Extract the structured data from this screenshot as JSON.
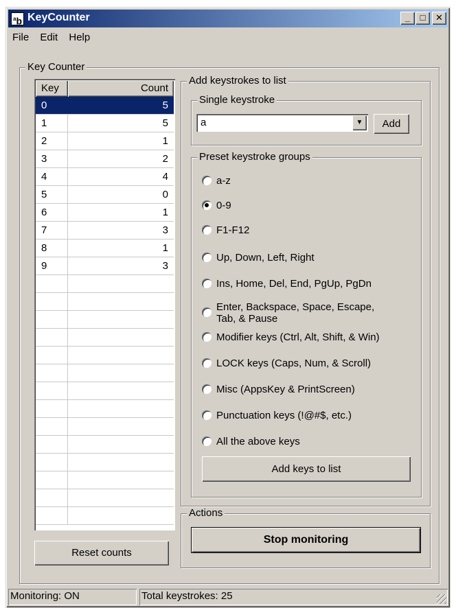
{
  "window": {
    "title": "KeyCounter",
    "icon_label": "ab",
    "minimize_label": "_",
    "maximize_label": "□",
    "close_label": "✕"
  },
  "menu": {
    "file": "File",
    "edit": "Edit",
    "help": "Help"
  },
  "key_counter": {
    "label": "Key Counter",
    "columns": {
      "key": "Key",
      "count": "Count"
    },
    "rows": [
      {
        "key": "0",
        "count": "5",
        "selected": true
      },
      {
        "key": "1",
        "count": "5"
      },
      {
        "key": "2",
        "count": "1"
      },
      {
        "key": "3",
        "count": "2"
      },
      {
        "key": "4",
        "count": "4"
      },
      {
        "key": "5",
        "count": "0"
      },
      {
        "key": "6",
        "count": "1"
      },
      {
        "key": "7",
        "count": "3"
      },
      {
        "key": "8",
        "count": "1"
      },
      {
        "key": "9",
        "count": "3"
      }
    ],
    "reset_button": "Reset counts"
  },
  "add_keystrokes": {
    "label": "Add keystrokes to list",
    "single": {
      "label": "Single keystroke",
      "value": "a",
      "add_button": "Add"
    },
    "preset": {
      "label": "Preset keystroke groups",
      "options": [
        {
          "label": "a-z",
          "checked": false
        },
        {
          "label": "0-9",
          "checked": true
        },
        {
          "label": "F1-F12",
          "checked": false
        },
        {
          "label": "Up, Down, Left, Right",
          "checked": false
        },
        {
          "label": "Ins, Home, Del, End, PgUp, PgDn",
          "checked": false
        },
        {
          "label": "Enter, Backspace, Space, Escape,\nTab, & Pause",
          "checked": false
        },
        {
          "label": "Modifier keys (Ctrl, Alt, Shift, & Win)",
          "checked": false
        },
        {
          "label": "LOCK keys (Caps, Num, & Scroll)",
          "checked": false
        },
        {
          "label": "Misc (AppsKey & PrintScreen)",
          "checked": false
        },
        {
          "label": "Punctuation keys (!@#$, etc.)",
          "checked": false
        },
        {
          "label": "All the above keys",
          "checked": false
        }
      ],
      "add_button": "Add keys to list"
    }
  },
  "actions": {
    "label": "Actions",
    "stop_button": "Stop monitoring"
  },
  "status": {
    "monitoring": "Monitoring: ON",
    "total": "Total keystrokes: 25"
  }
}
